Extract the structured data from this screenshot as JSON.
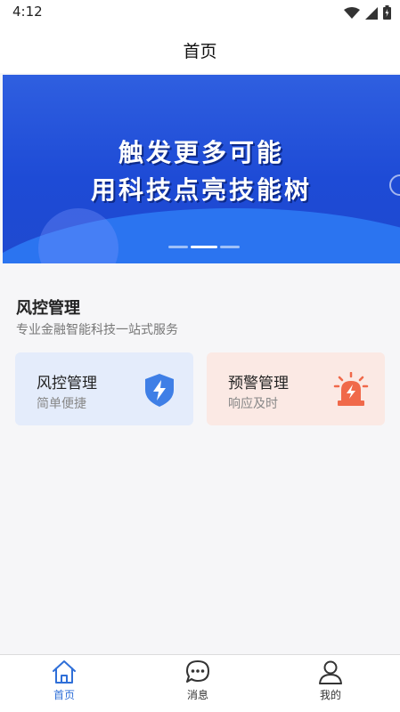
{
  "status_bar": {
    "time": "4:12",
    "icons": [
      "wifi-icon",
      "signal-icon",
      "battery-icon"
    ]
  },
  "header": {
    "title": "首页"
  },
  "banner": {
    "line1": "触发更多可能",
    "line2": "用科技点亮技能树",
    "active_slide_index": 1,
    "slide_count": 3,
    "colors": {
      "background": "#1e4bd6",
      "wave": "#2b74f0"
    }
  },
  "section": {
    "title": "风控管理",
    "subtitle": "专业金融智能科技一站式服务"
  },
  "cards": [
    {
      "title": "风控管理",
      "description": "简单便捷",
      "icon": "shield-lightning-icon",
      "background": "#e4ecfb",
      "icon_color": "#3f7fe6"
    },
    {
      "title": "预警管理",
      "description": "响应及时",
      "icon": "alarm-siren-icon",
      "background": "#fbe9e4",
      "icon_color": "#f0694a"
    }
  ],
  "tab_bar": {
    "active": "home",
    "accent_color": "#2f6fd8",
    "tabs": [
      {
        "label": "首页",
        "icon": "home-icon"
      },
      {
        "label": "消息",
        "icon": "message-icon"
      },
      {
        "label": "我的",
        "icon": "user-icon"
      }
    ]
  }
}
